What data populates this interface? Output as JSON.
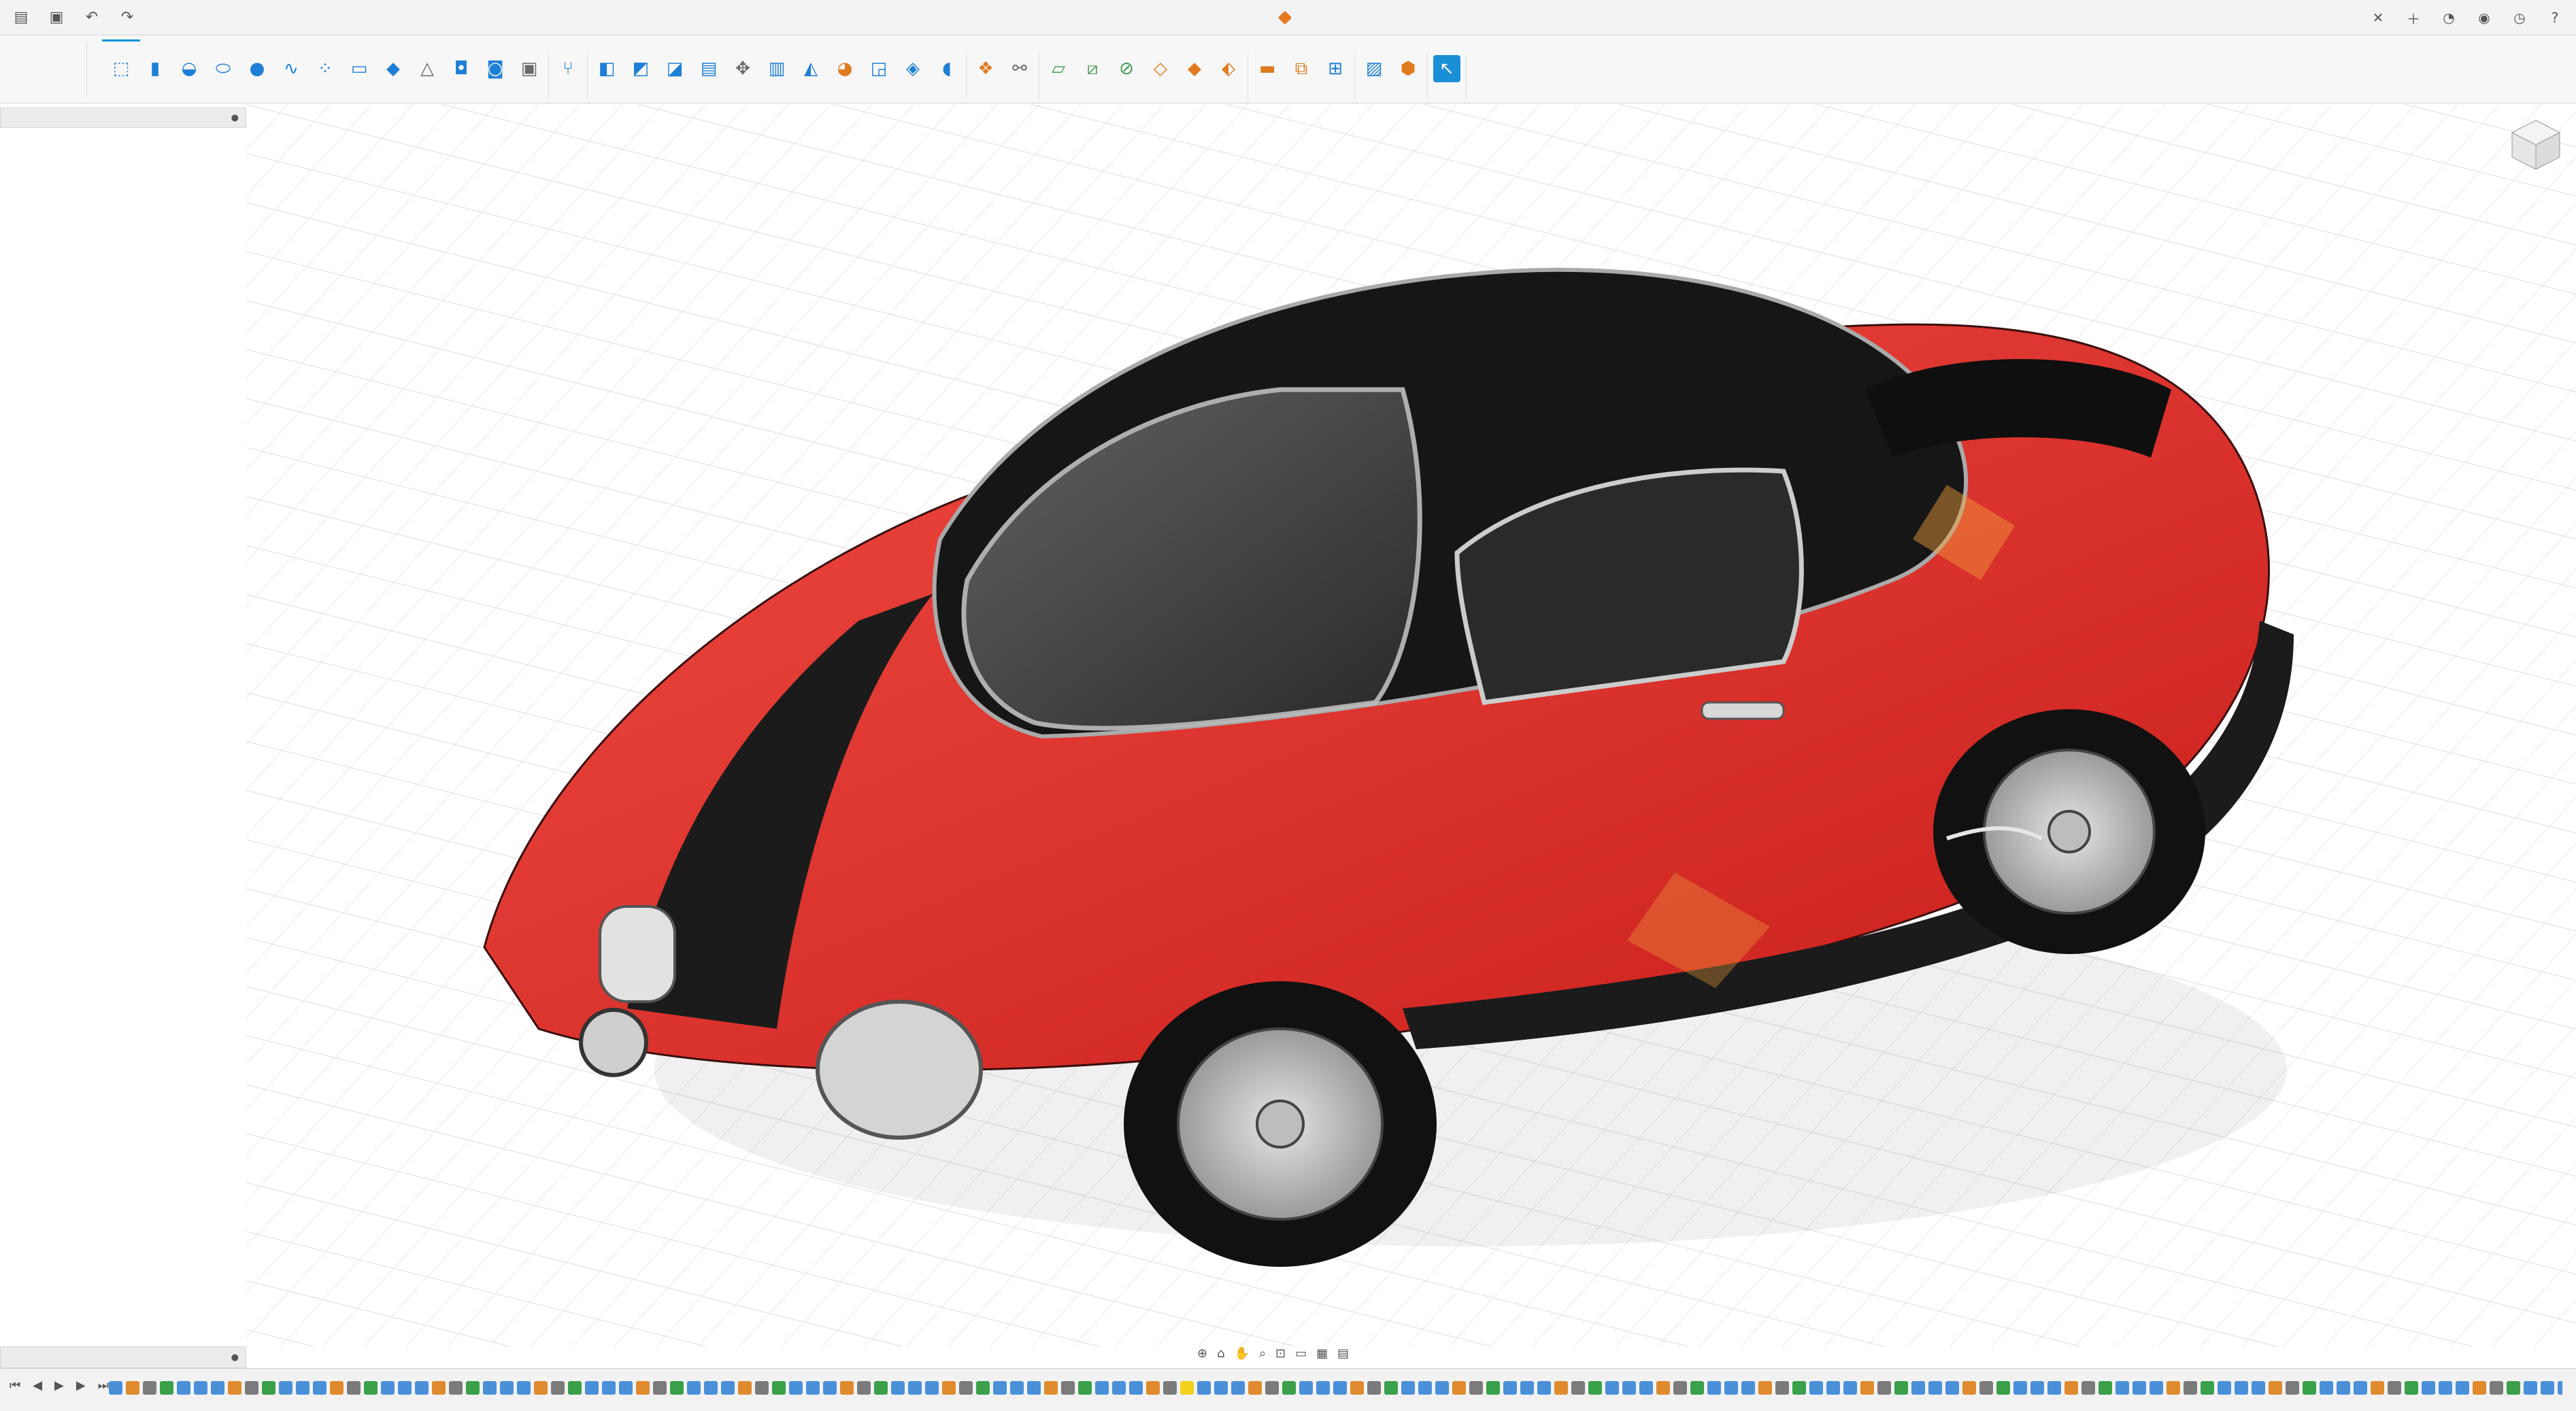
{
  "window": {
    "title": "",
    "icons": {
      "file": "file-menu-icon",
      "save": "save-icon",
      "undo": "undo-icon",
      "redo": "redo-icon"
    }
  },
  "ribbon": {
    "workspace": "",
    "tabs": [
      {
        "label": "",
        "active": true
      },
      {
        "label": ""
      },
      {
        "label": ""
      },
      {
        "label": ""
      },
      {
        "label": ""
      },
      {
        "label": ""
      }
    ],
    "groups": [
      {
        "label": ""
      },
      {
        "label": ""
      },
      {
        "label": ""
      },
      {
        "label": ""
      },
      {
        "label": ""
      },
      {
        "label": ""
      },
      {
        "label": ""
      },
      {
        "label": ""
      }
    ]
  },
  "browser": {
    "title": "",
    "items": []
  },
  "comments": {
    "title": ""
  },
  "colors": {
    "accent": "#0696d7",
    "car_red": "#e8302c",
    "car_black": "#1b1b1b",
    "grid": "#dcdcdc"
  }
}
